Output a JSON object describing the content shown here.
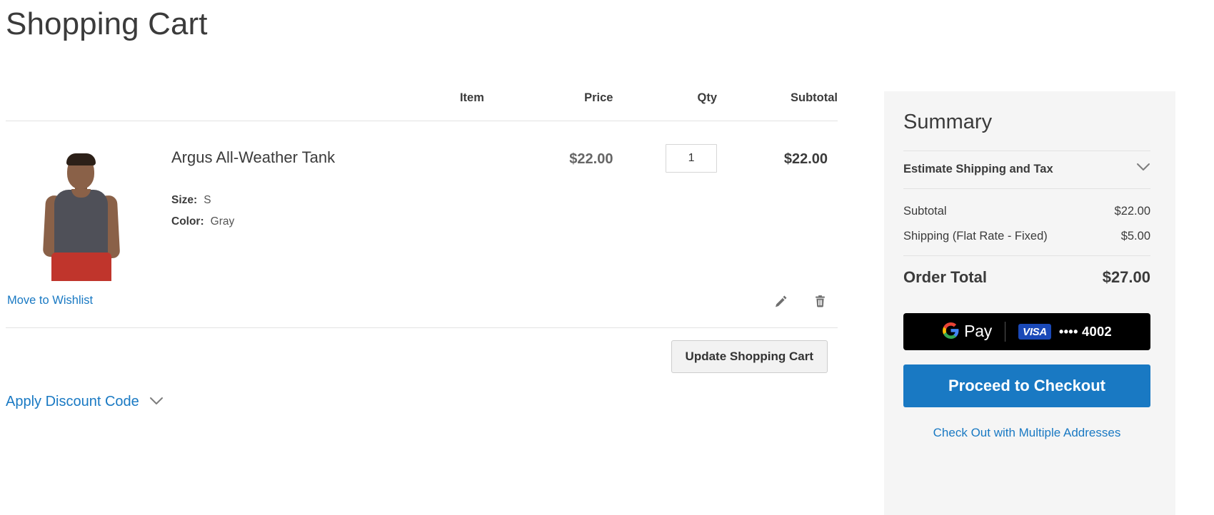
{
  "page": {
    "title": "Shopping Cart"
  },
  "cart_table": {
    "headers": {
      "item": "Item",
      "price": "Price",
      "qty": "Qty",
      "subtotal": "Subtotal"
    },
    "rows": [
      {
        "name": "Argus All-Weather Tank",
        "options": [
          {
            "label": "Size:",
            "value": "S"
          },
          {
            "label": "Color:",
            "value": "Gray"
          }
        ],
        "price": "$22.00",
        "qty": "1",
        "subtotal": "$22.00"
      }
    ]
  },
  "item_actions": {
    "wishlist_link": "Move to Wishlist",
    "edit_icon": "pencil-icon",
    "remove_icon": "trash-icon"
  },
  "cart_actions": {
    "update_label": "Update Shopping Cart",
    "discount_label": "Apply Discount Code",
    "discount_chevron": "chevron-down-icon"
  },
  "summary": {
    "title": "Summary",
    "estimate": {
      "label": "Estimate Shipping and Tax",
      "chevron": "chevron-down-icon"
    },
    "totals": [
      {
        "label": "Subtotal",
        "amount": "$22.00"
      },
      {
        "label": "Shipping (Flat Rate - Fixed)",
        "amount": "$5.00"
      }
    ],
    "grand_total": {
      "label": "Order Total",
      "amount": "$27.00"
    },
    "gpay": {
      "brand": "Pay",
      "card_network": "VISA",
      "card_mask": "•••• 4002"
    },
    "checkout_label": "Proceed to Checkout",
    "multi_address_label": "Check Out with Multiple Addresses"
  },
  "colors": {
    "link": "#1979c3",
    "primary_button": "#1979c3",
    "gpay_background": "#000000",
    "visa_blue": "#1a49b8",
    "summary_background": "#f5f5f5",
    "text": "#3b3b3b"
  }
}
